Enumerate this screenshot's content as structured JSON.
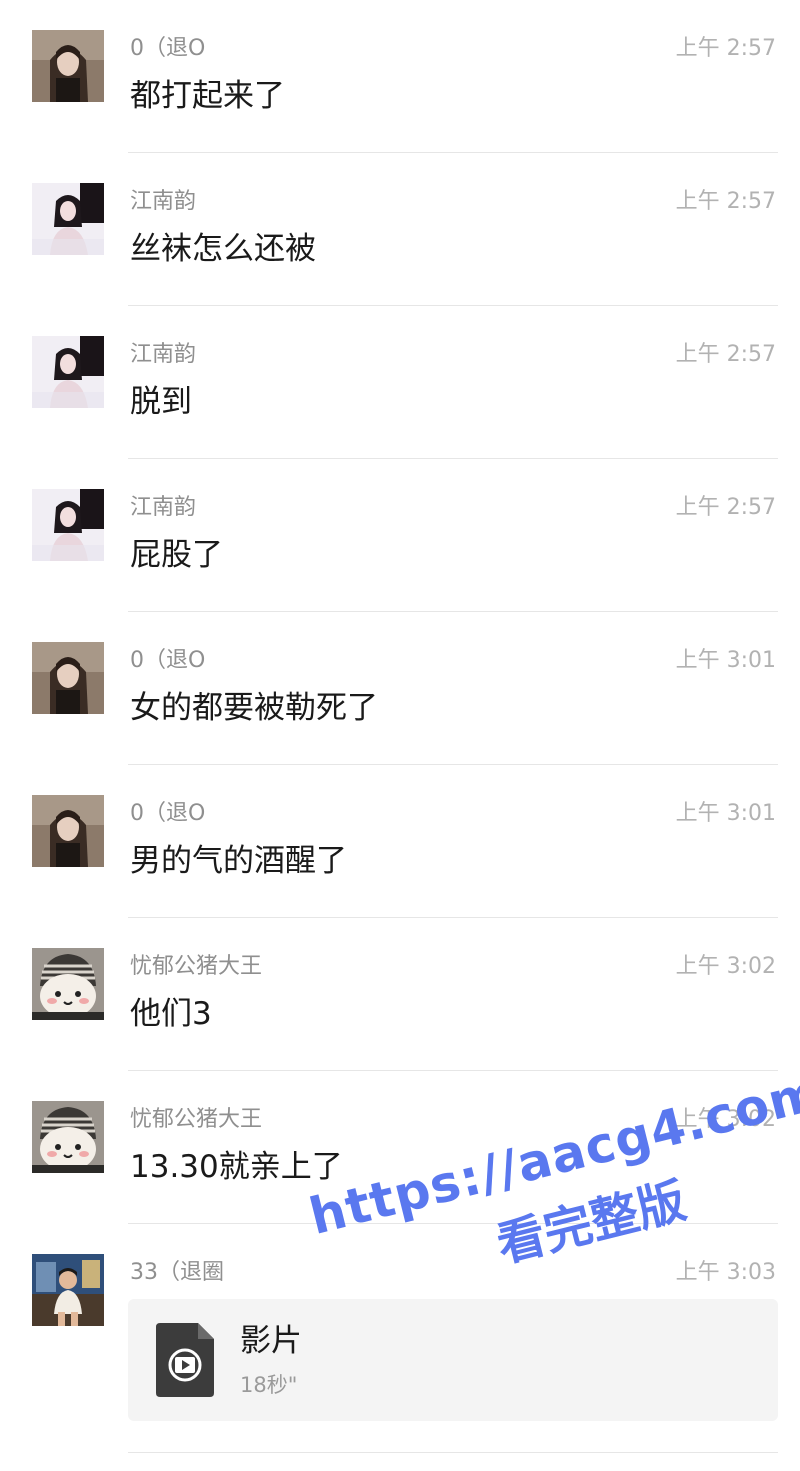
{
  "messages": [
    {
      "sender": "0（退O",
      "time": "上午 2:57",
      "text": "都打起来了",
      "avatar": "avatar-girl-long-hair"
    },
    {
      "sender": "江南韵",
      "time": "上午 2:57",
      "text": "丝袜怎么还被",
      "avatar": "avatar-girl-dark"
    },
    {
      "sender": "江南韵",
      "time": "上午 2:57",
      "text": "脱到",
      "avatar": "avatar-girl-dark"
    },
    {
      "sender": "江南韵",
      "time": "上午 2:57",
      "text": "屁股了",
      "avatar": "avatar-girl-dark"
    },
    {
      "sender": "0（退O",
      "time": "上午 3:01",
      "text": "女的都要被勒死了",
      "avatar": "avatar-girl-long-hair"
    },
    {
      "sender": "0（退O",
      "time": "上午 3:01",
      "text": "男的气的酒醒了",
      "avatar": "avatar-girl-long-hair"
    },
    {
      "sender": "忧郁公猪大王",
      "time": "上午 3:02",
      "text": "他们3",
      "avatar": "avatar-plush-toy"
    },
    {
      "sender": "忧郁公猪大王",
      "time": "上午 3:02",
      "text": "13.30就亲上了",
      "avatar": "avatar-plush-toy"
    }
  ],
  "last_message": {
    "sender": "33（退圈",
    "time": "上午 3:03",
    "avatar": "avatar-child-photo",
    "file": {
      "name": "影片",
      "duration": "18秒\"",
      "icon": "video-file-icon"
    }
  },
  "watermark": {
    "line1": "https://aacg4.com",
    "line2": "看完整版",
    "color": "#5a78ef"
  }
}
